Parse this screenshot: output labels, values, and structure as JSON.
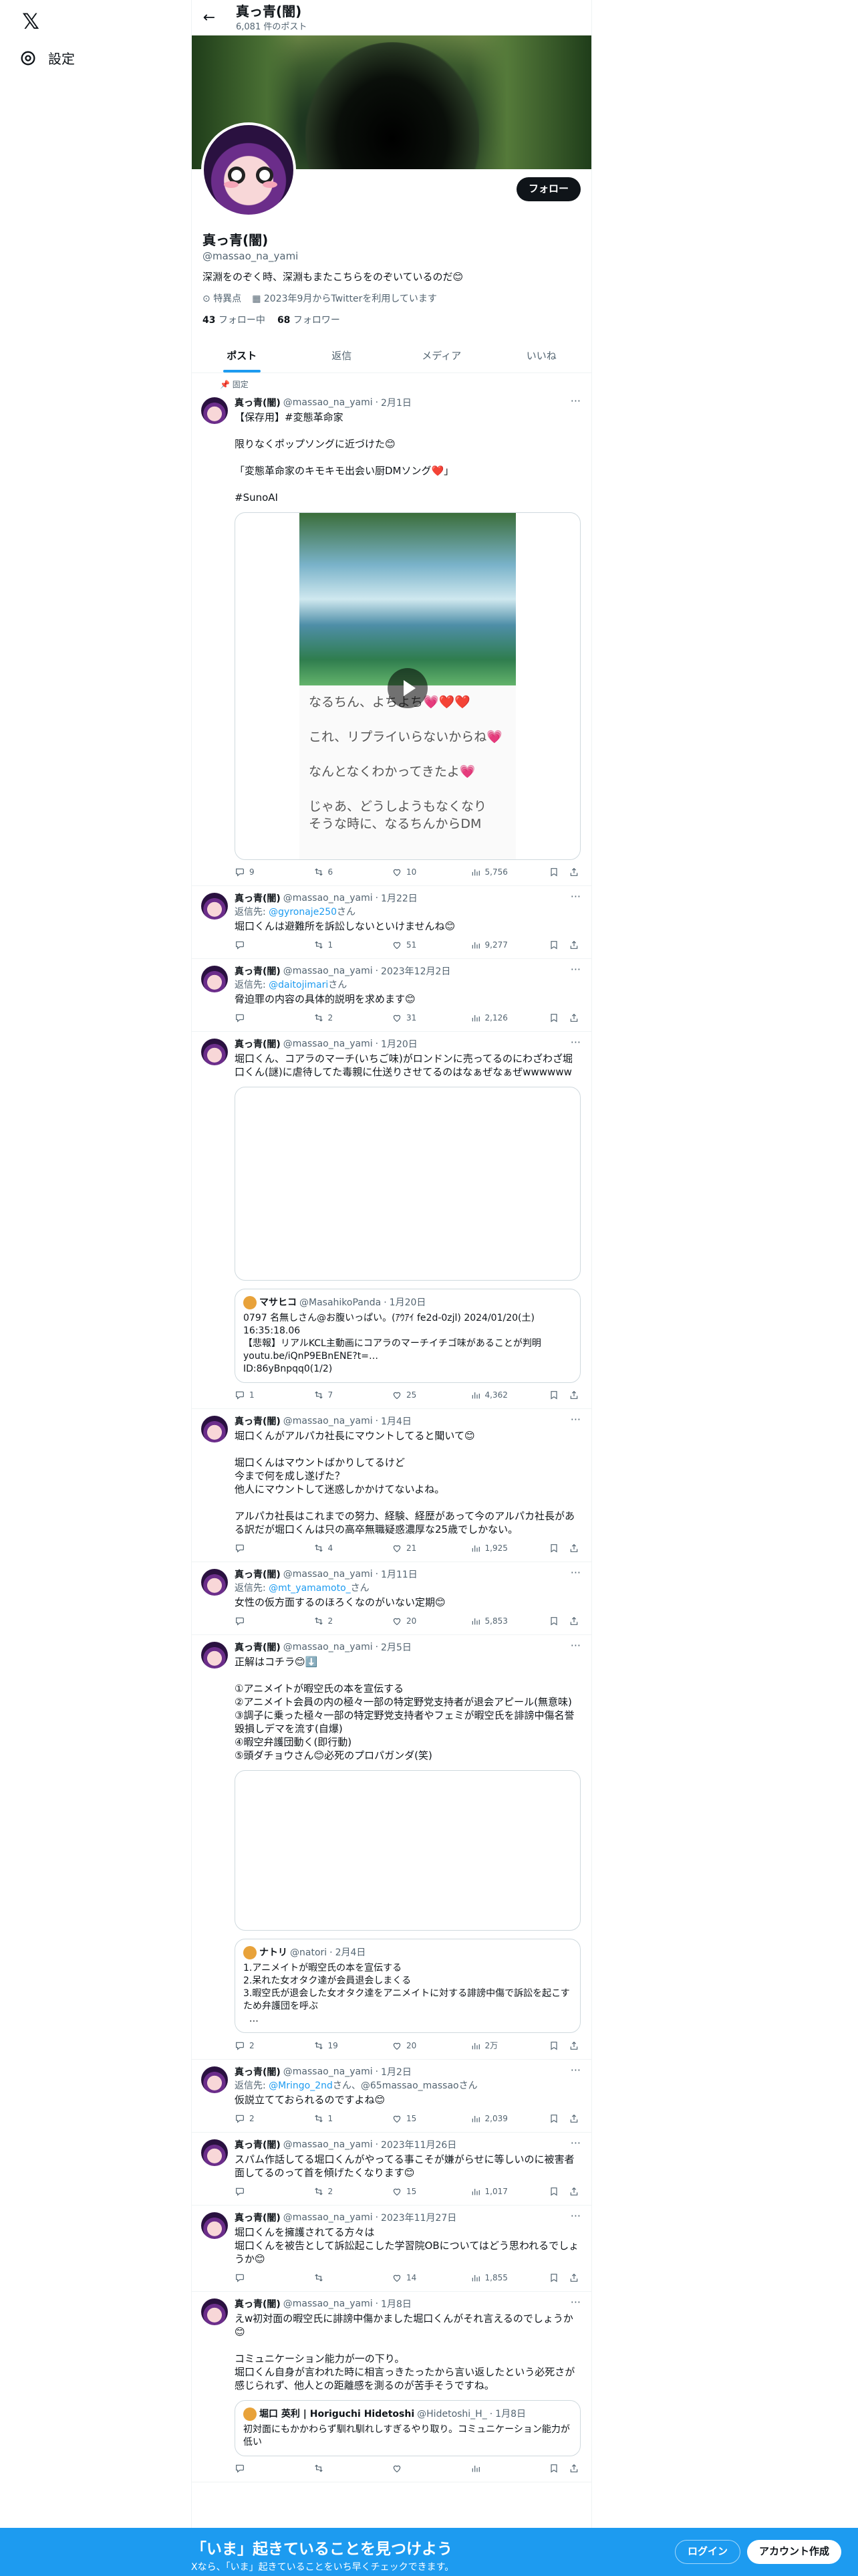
{
  "nav": {
    "settings": "設定"
  },
  "header": {
    "name": "真っ青(闇)",
    "post_count": "6,081 件のポスト"
  },
  "profile": {
    "follow": "フォロー",
    "name": "真っ青(闇)",
    "handle": "@massao_na_yami",
    "bio": "深淵をのぞく時、深淵もまたこちらをのぞいているのだ😊",
    "location": "特異点",
    "joined": "2023年9月からTwitterを利用しています",
    "following_count": "43",
    "following_label": "フォロー中",
    "followers_count": "68",
    "followers_label": "フォロワー"
  },
  "tabs": [
    "ポスト",
    "返信",
    "メディア",
    "いいね"
  ],
  "pinned_label": "固定",
  "tweets": [
    {
      "name": "真っ青(闇)",
      "handle": "@massao_na_yami",
      "date": "2月1日",
      "body": "【保存用】#変態革命家\n\n限りなくポップソングに近づけた😊\n\n「変態革命家のキモキモ出会い厨DMソング❤️」\n\n#SunoAI",
      "video_text": "なるちん、よちよち💗❤️❤️\n\nこれ、リプライいらないからね💗\n\nなんとなくわかってきたよ💗\n\nじゃあ、どうしようもなくなり\nそうな時に、なるちんからDM",
      "reply": "9",
      "retweet": "6",
      "like": "10",
      "views": "5,756"
    },
    {
      "name": "真っ青(闇)",
      "handle": "@massao_na_yami",
      "date": "1月22日",
      "reply_to": "@gyronaje250",
      "reply_suffix": "さん",
      "body": "堀口くんは避難所を訴訟しないといけませんね😊",
      "reply": "",
      "retweet": "1",
      "like": "51",
      "views": "9,277"
    },
    {
      "name": "真っ青(闇)",
      "handle": "@massao_na_yami",
      "date": "2023年12月2日",
      "reply_to": "@daitojimari",
      "reply_suffix": "さん",
      "body": "脅迫罪の内容の具体的説明を求めます😊",
      "reply": "",
      "retweet": "2",
      "like": "31",
      "views": "2,126"
    },
    {
      "name": "真っ青(闇)",
      "handle": "@massao_na_yami",
      "date": "1月20日",
      "body": "堀口くん、コアラのマーチ(いちご味)がロンドンに売ってるのにわざわざ堀口くん(謎)に虐待してた毒親に仕送りさせてるのはなぁぜなぁぜwwwwww",
      "quote_name": "マサヒコ",
      "quote_handle": "@MasahikoPanda",
      "quote_date": "1月20日",
      "quote_body": "0797 名無しさん@お腹いっぱい。(ｱｳｱｲ fe2d-0zjl) 2024/01/20(土) 16:35:18.06\n【悲報】リアルKCL主動画にコアラのマーチイチゴ味があることが判明\nyoutu.be/iQnP9EBnENE?t=…\nID:86yBnpqq0(1/2)",
      "reply": "1",
      "retweet": "7",
      "like": "25",
      "views": "4,362"
    },
    {
      "name": "真っ青(闇)",
      "handle": "@massao_na_yami",
      "date": "1月4日",
      "body": "堀口くんがアルパカ社長にマウントしてると聞いて😊\n\n堀口くんはマウントばかりしてるけど\n今まで何を成し遂げた？\n他人にマウントして迷惑しかかけてないよね。\n\nアルパカ社長はこれまでの努力、経験、経歴があって今のアルパカ社長がある訳だが堀口くんは只の高卒無職疑惑濃厚な25歳でしかない。",
      "reply": "",
      "retweet": "4",
      "like": "21",
      "views": "1,925"
    },
    {
      "name": "真っ青(闇)",
      "handle": "@massao_na_yami",
      "date": "1月11日",
      "reply_to": "@mt_yamamoto_",
      "reply_suffix": "さん",
      "body": "女性の仮方面するのほろくなのがいない定期😊",
      "reply": "",
      "retweet": "2",
      "like": "20",
      "views": "5,853"
    },
    {
      "name": "真っ青(闇)",
      "handle": "@massao_na_yami",
      "date": "2月5日",
      "body": "正解はコチラ😊⬇️\n\n①アニメイトが暇空氏の本を宣伝する\n②アニメイト会員の内の極々一部の特定野党支持者が退会アピール(無意味)\n③調子に乗った極々一部の特定野党支持者やフェミが暇空氏を誹謗中傷名誉毀損しデマを流す(自爆)\n④暇空弁護団動く(即行動)\n⑤頭ダチョウさん😊必死のプロパガンダ(笑)",
      "quote_name": "ナトリ",
      "quote_handle": "@natori",
      "quote_date": "2月4日",
      "quote_body": "1.アニメイトが暇空氏の本を宣伝する\n2.呆れた女オタク達が会員退会しまくる\n3.暇空氏が退会した女オタク達をアニメイトに対する誹謗中傷で訴訟を起こすため弁護団を呼ぶ\n  …",
      "reply": "2",
      "retweet": "19",
      "like": "20",
      "views": "2万"
    },
    {
      "name": "真っ青(闇)",
      "handle": "@massao_na_yami",
      "date": "1月2日",
      "reply_to": "@Mringo_2nd",
      "reply_suffix": "さん、@65massao_massaoさん",
      "body": "仮説立てておられるのですよね😊",
      "reply": "2",
      "retweet": "1",
      "like": "15",
      "views": "2,039"
    },
    {
      "name": "真っ青(闇)",
      "handle": "@massao_na_yami",
      "date": "2023年11月26日",
      "body": "スパム作話してる堀口くんがやってる事こそが嫌がらせに等しいのに被害者面してるのって首を傾げたくなります😊",
      "reply": "",
      "retweet": "2",
      "like": "15",
      "views": "1,017"
    },
    {
      "name": "真っ青(闇)",
      "handle": "@massao_na_yami",
      "date": "2023年11月27日",
      "body": "堀口くんを擁護されてる方々は\n堀口くんを被告として訴訟起こした学習院OBについてはどう思われるでしょうか😊",
      "reply": "",
      "retweet": "",
      "like": "14",
      "views": "1,855"
    },
    {
      "name": "真っ青(闇)",
      "handle": "@massao_na_yami",
      "date": "1月8日",
      "body": "えw初対面の暇空氏に誹謗中傷かました堀口くんがそれ言えるのでしょうか😊\n\nコミュニケーション能力が一の下り。\n堀口くん自身が言われた時に相言っきたったから言い返したという必死さが感じられず、他人との距離感を測るのが苦手そうですね。",
      "quote_name": "堀口 英利 | Horiguchi Hidetoshi",
      "quote_handle": "@Hidetoshi_H_",
      "quote_date": "1月8日",
      "quote_body": "初対面にもかかわらず馴れ馴れしすぎるやり取り。コミュニケーション能力が低い",
      "reply": "",
      "retweet": "",
      "like": "",
      "views": ""
    }
  ],
  "bottom": {
    "title": "「いま」起きていることを見つけよう",
    "subtitle": "Xなら、「いま」起きていることをいち早くチェックできます。",
    "login": "ログイン",
    "signup": "アカウント作成"
  }
}
